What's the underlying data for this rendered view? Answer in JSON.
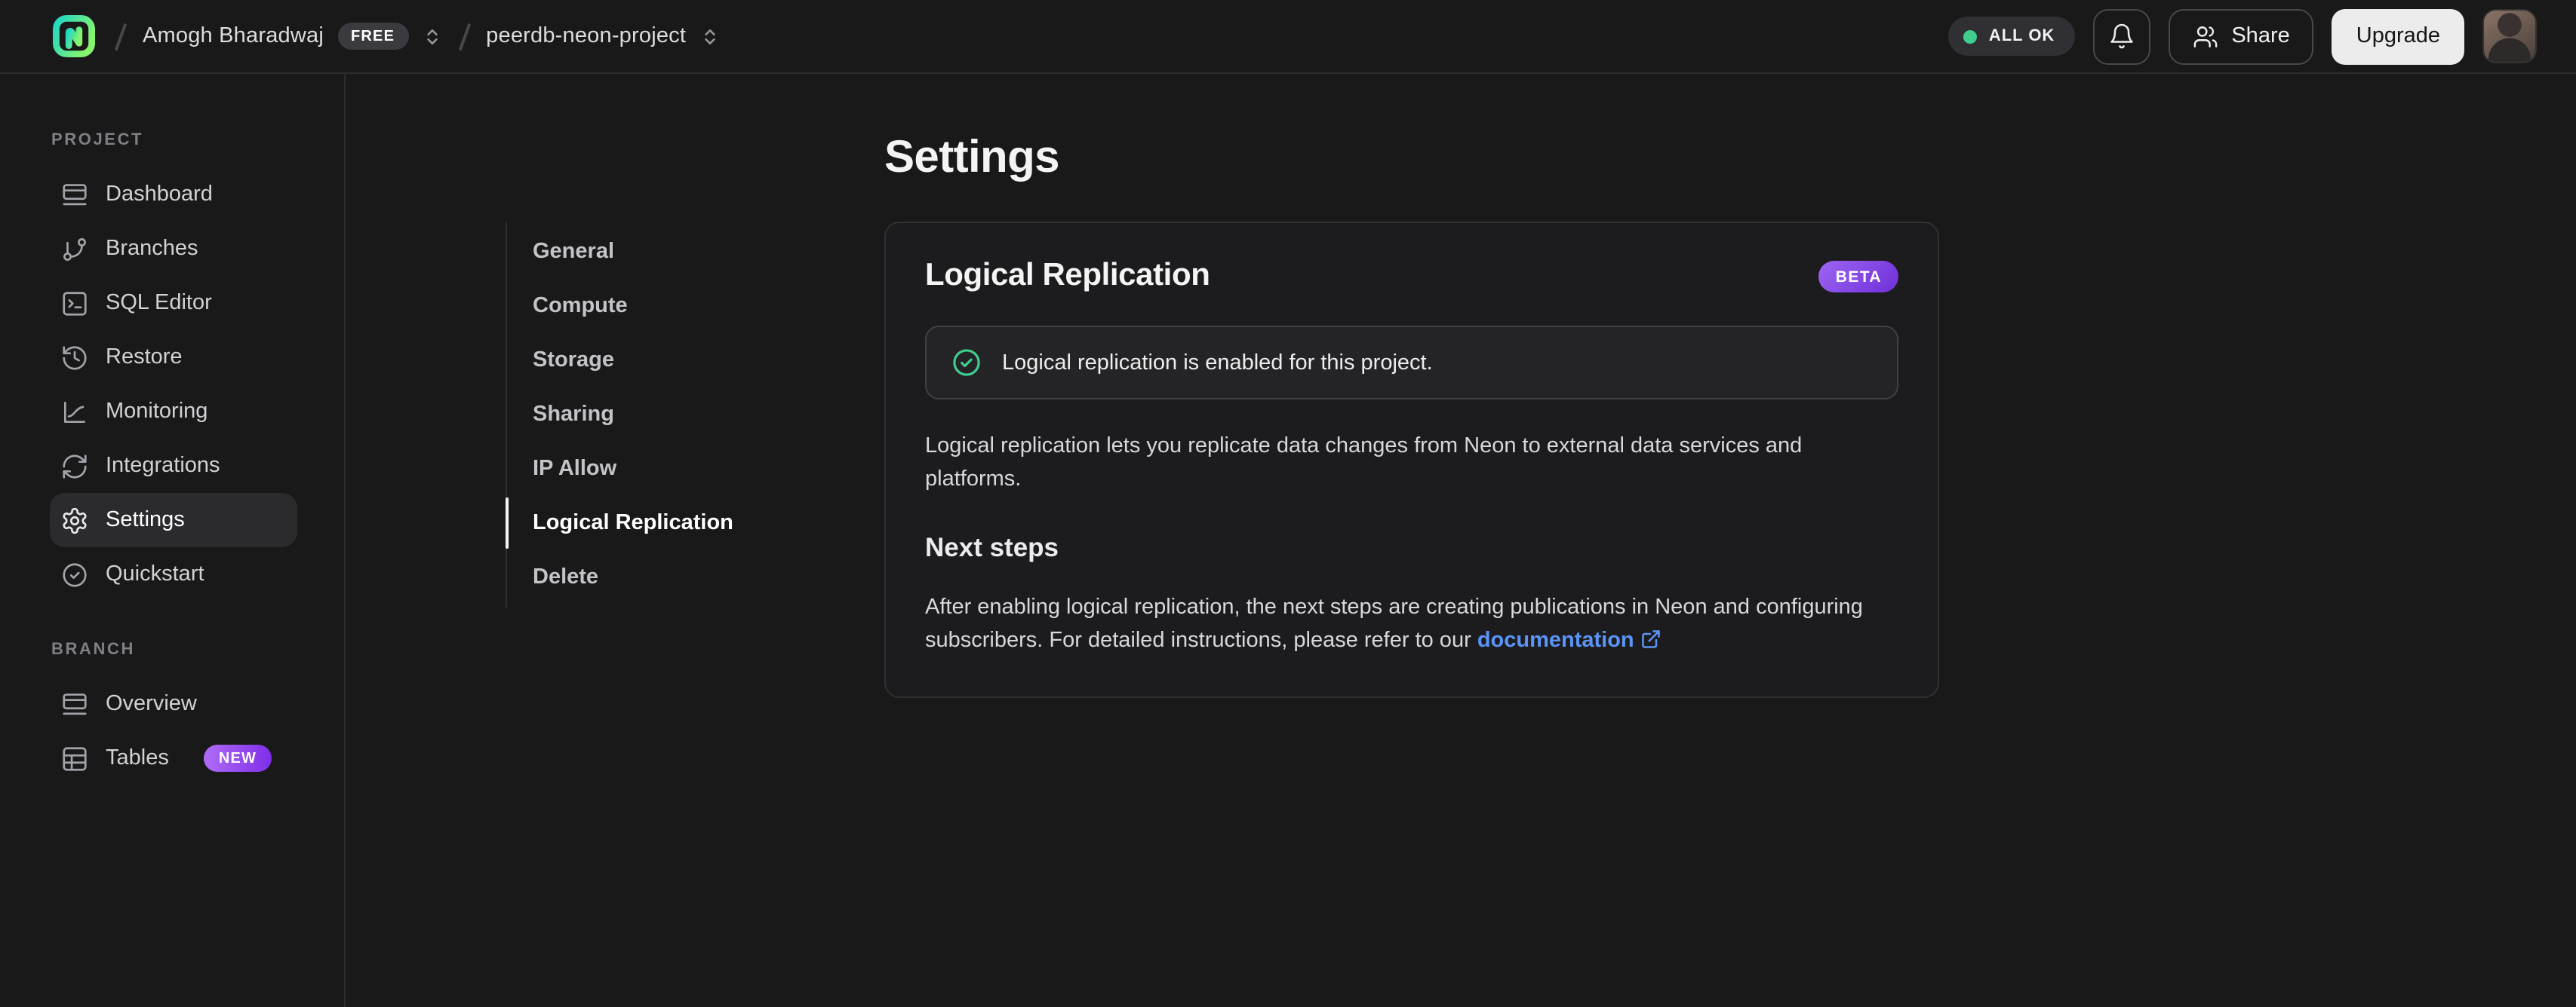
{
  "topbar": {
    "org": {
      "name": "Amogh Bharadwaj",
      "plan_badge": "FREE"
    },
    "project": {
      "name": "peerdb-neon-project"
    },
    "status": {
      "label": "ALL OK"
    },
    "share_label": "Share",
    "upgrade_label": "Upgrade",
    "icons": [
      "neon-logo",
      "bell-icon",
      "users-icon",
      "user-avatar",
      "up-down-chevrons-icon"
    ]
  },
  "sidebar": {
    "sections": [
      {
        "title": "PROJECT",
        "items": [
          {
            "label": "Dashboard",
            "icon": "dashboard-icon"
          },
          {
            "label": "Branches",
            "icon": "git-branch-icon"
          },
          {
            "label": "SQL Editor",
            "icon": "terminal-icon"
          },
          {
            "label": "Restore",
            "icon": "history-icon"
          },
          {
            "label": "Monitoring",
            "icon": "chart-icon"
          },
          {
            "label": "Integrations",
            "icon": "integrations-icon"
          },
          {
            "label": "Settings",
            "icon": "gear-icon",
            "active": true
          },
          {
            "label": "Quickstart",
            "icon": "circle-check-icon"
          }
        ]
      },
      {
        "title": "BRANCH",
        "items": [
          {
            "label": "Overview",
            "icon": "window-icon"
          },
          {
            "label": "Tables",
            "icon": "table-icon",
            "badge": "NEW"
          }
        ]
      }
    ]
  },
  "main": {
    "page_title": "Settings",
    "nav": {
      "items": [
        "General",
        "Compute",
        "Storage",
        "Sharing",
        "IP Allow",
        "Logical Replication",
        "Delete"
      ],
      "active": "Logical Replication"
    },
    "card": {
      "title": "Logical Replication",
      "badge": "BETA",
      "alert_text": "Logical replication is enabled for this project.",
      "description": "Logical replication lets you replicate data changes from Neon to external data services and platforms.",
      "next_steps_title": "Next steps",
      "next_steps_text_before_link": "After enabling logical replication, the next steps are creating publications in Neon and configuring subscribers. For detailed instructions, please refer to our ",
      "link_label": "documentation"
    }
  },
  "colors": {
    "background": "#19191a",
    "card_background": "#1c1c1e",
    "card_border": "#303034",
    "alert_background": "#242427",
    "alert_border": "#404045",
    "selected_item_background": "#2b2b2e",
    "topbar_border": "#2c2c2f",
    "accent_green": "#00e599",
    "success_green": "#3ecf8e",
    "link_blue": "#5b94f6",
    "badge_purple_gradient": [
      "#9d66f3",
      "#6f2fd8"
    ],
    "new_badge_gradient": [
      "#b06cf6",
      "#7f2fe8"
    ],
    "upgrade_button_background": "#ececed",
    "text_primary": "#f4f4f5",
    "text_secondary": "#d2d2d5",
    "text_muted": "#7f7f86"
  }
}
